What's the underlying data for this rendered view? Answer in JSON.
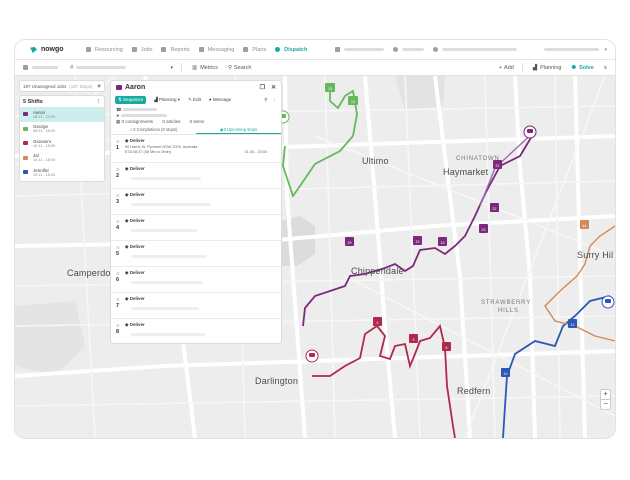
{
  "app": {
    "brand": "nowgo"
  },
  "nav": {
    "items": [
      {
        "label": "Resourcing",
        "icon": "users-icon"
      },
      {
        "label": "Jobs",
        "icon": "jobs-icon"
      },
      {
        "label": "Reports",
        "icon": "reports-icon"
      },
      {
        "label": "Messaging",
        "icon": "message-icon"
      },
      {
        "label": "Plans",
        "icon": "folder-icon"
      },
      {
        "label": "Dispatch",
        "icon": "pin-icon",
        "active": true
      }
    ]
  },
  "toolbar": {
    "metrics": "Metrics",
    "search": "Search",
    "add": "Add",
    "planning": "Planning",
    "solve": "Solve"
  },
  "unassigned": {
    "label": "197 Unassigned Jobs",
    "sub": "(197 Stops)"
  },
  "shifts": {
    "title": "5 Shifts",
    "rows": [
      {
        "name": "Aaron",
        "time": "08:21 - 13:00",
        "color": "#7b2a7b",
        "selected": true
      },
      {
        "name": "George",
        "time": "08:21 - 15:00",
        "color": "#66b85e"
      },
      {
        "name": "Giovanni",
        "time": "10:11 - 15:00",
        "color": "#b0294f"
      },
      {
        "name": "Jal",
        "time": "10:11 - 15:00",
        "color": "#d4895a"
      },
      {
        "name": "Jennifer",
        "time": "10:11 - 15:00",
        "color": "#2c57b8"
      }
    ]
  },
  "driver": {
    "name": "Aaron",
    "actions": {
      "sequence": "Sequence",
      "planning": "Planning",
      "edit": "Edit",
      "message": "Message"
    },
    "stats": {
      "consignments": "0 consignments",
      "articles": "0 articles",
      "items": "0 items"
    },
    "tabs": {
      "completions": "0 Completions (0 stops)",
      "upcoming": "0 Upcoming stops"
    },
    "stops": [
      {
        "num": "1",
        "kind": "Deliver",
        "address": "50 Harris St, Pyrmont NSW 2009, Australia",
        "eta": "ETA 08:37 (38 Min to 5min)",
        "window": "01:30 - 23:00"
      },
      {
        "num": "2",
        "kind": "Deliver"
      },
      {
        "num": "3",
        "kind": "Deliver"
      },
      {
        "num": "4",
        "kind": "Deliver"
      },
      {
        "num": "5",
        "kind": "Deliver"
      },
      {
        "num": "6",
        "kind": "Deliver"
      },
      {
        "num": "7",
        "kind": "Deliver"
      },
      {
        "num": "8",
        "kind": "Deliver"
      }
    ]
  },
  "map": {
    "labels": {
      "ultimo": "Ultimo",
      "chinatown": "CHINATOWN",
      "haymarket": "Haymarket",
      "chippendale": "Chippendale",
      "camperdown": "Camperdo",
      "surry": "Surry Hil",
      "strawberry": "STRAWBERRY",
      "hills": "HILLS",
      "darlington": "Darlington",
      "redfern": "Redfern"
    },
    "zoom_in": "+",
    "zoom_out": "−"
  },
  "colors": {
    "accent": "#1ba9a0",
    "purple": "#7b2a7b",
    "green": "#66b85e",
    "crimson": "#b0294f",
    "orange": "#d4895a",
    "blue": "#2c57b8"
  }
}
